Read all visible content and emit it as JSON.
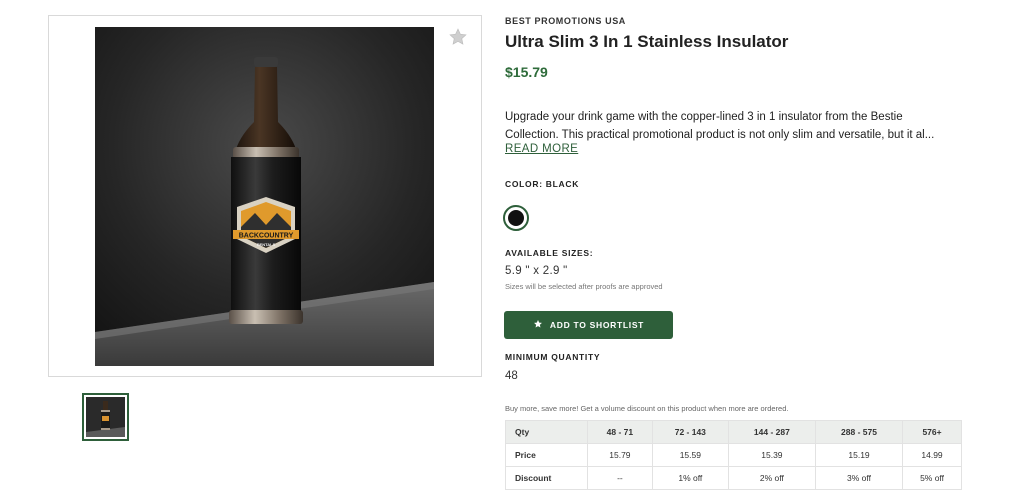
{
  "product": {
    "brand": "BEST PROMOTIONS USA",
    "title": "Ultra Slim 3 In 1 Stainless Insulator",
    "price": "$15.79",
    "description_line1": "Upgrade your drink game with the copper-lined 3 in 1 insulator from the Bestie",
    "description_line2": "Collection. This practical promotional product is not only slim and versatile, but it al...",
    "read_more": "READ MORE",
    "image_logo_line1": "BACKCOUNTRY",
    "image_logo_line2": "RENTALS"
  },
  "color": {
    "label": "COLOR: BLACK",
    "swatch_hex": "#111111"
  },
  "sizes": {
    "label": "AVAILABLE SIZES:",
    "value": "5.9 \" x 2.9 \"",
    "note": "Sizes will be selected after proofs are approved"
  },
  "shortlist": {
    "button_label": "ADD TO SHORTLIST",
    "icon": "star-icon"
  },
  "favorite": {
    "icon": "star-icon"
  },
  "minimum_quantity": {
    "label": "MINIMUM QUANTITY",
    "value": "48"
  },
  "pricing": {
    "note": "Buy more, save more! Get a volume discount on this product when more are ordered.",
    "header": [
      "Qty",
      "48 - 71",
      "72 - 143",
      "144 - 287",
      "288 - 575",
      "576+"
    ],
    "price_row": [
      "Price",
      "15.79",
      "15.59",
      "15.39",
      "15.19",
      "14.99"
    ],
    "discount_row": [
      "Discount",
      "--",
      "1% off",
      "2% off",
      "3% off",
      "5% off"
    ]
  },
  "colors": {
    "accent": "#2e5f3a",
    "price": "#2e6b3a"
  }
}
